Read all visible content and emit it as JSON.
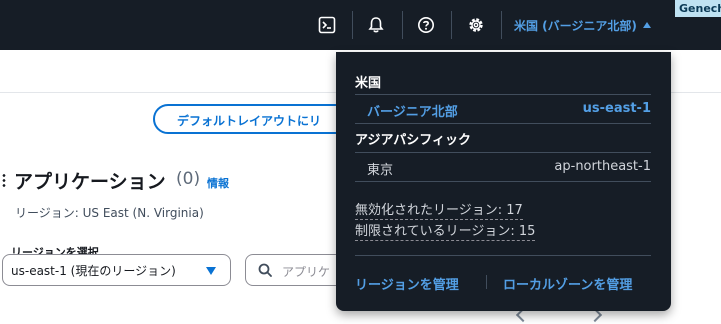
{
  "topbar": {
    "icons": [
      "cloudshell-icon",
      "bell-icon",
      "help-icon",
      "gear-icon"
    ],
    "region_label": "米国 (バージニア北部)",
    "account_label": "Genech",
    "account_chip_color": "#bfe2f2"
  },
  "page": {
    "layout_button_label": "デフォルトレイアウトにリ",
    "app_title": "アプリケーション",
    "app_count": "(0)",
    "info_link": "情報",
    "region_caption": "リージョン: US East (N. Virginia)",
    "select_label": "リージョンを選択",
    "select_value": "us-east-1 (現在のリージョン)",
    "search_placeholder": "アプリケ"
  },
  "dropdown": {
    "groups": [
      {
        "title": "米国",
        "items": [
          {
            "name": "バージニア北部",
            "code": "us-east-1",
            "selected": true
          }
        ]
      },
      {
        "title": "アジアパシフィック",
        "items": [
          {
            "name": "東京",
            "code": "ap-northeast-1",
            "selected": false
          }
        ]
      }
    ],
    "disabled_regions": "無効化されたリージョン: 17",
    "restricted_regions": "制限されているリージョン: 15",
    "manage_regions": "リージョンを管理",
    "manage_local_zones": "ローカルゾーンを管理"
  },
  "colors": {
    "nav_background": "#161d26",
    "accent_link": "#539fe5",
    "primary_blue": "#0972d3"
  }
}
